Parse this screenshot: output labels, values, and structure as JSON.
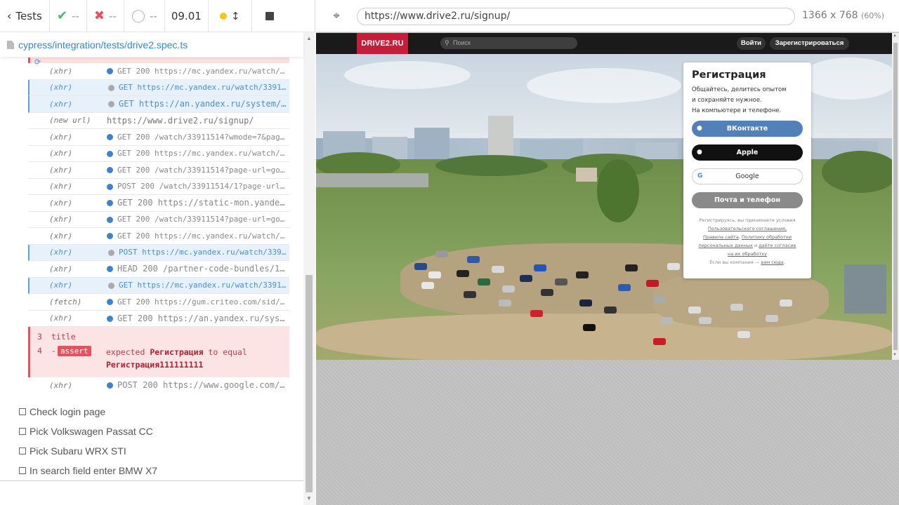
{
  "reporter": {
    "header": {
      "tests_label": "Tests",
      "passed": "--",
      "failed": "--",
      "pending": "--",
      "duration": "09.01"
    },
    "spec_path": "cypress/integration/tests/drive2.spec.ts",
    "commands": [
      {
        "kind": "(xhr)",
        "dot": "blue",
        "text": "GET 200 https://mc.yandex.ru/watch/339115…",
        "pending": false
      },
      {
        "kind": "(xhr)",
        "dot": "grey",
        "text": "GET https://mc.yandex.ru/watch/33911514?p…",
        "pending": true
      },
      {
        "kind": "(xhr)",
        "dot": "grey",
        "text": "GET https://an.yandex.ru/system/co…",
        "pending": true,
        "big": true
      },
      {
        "kind": "(new url)",
        "text": "https://www.drive2.ru/signup/",
        "newurl": true
      },
      {
        "kind": "(xhr)",
        "dot": "blue",
        "text": "GET 200 /watch/33911514?wmode=7&page-url=…",
        "pending": false
      },
      {
        "kind": "(xhr)",
        "dot": "blue",
        "text": "GET 200 https://mc.yandex.ru/watch/339115…",
        "pending": false
      },
      {
        "kind": "(xhr)",
        "dot": "blue",
        "text": "GET 200 /watch/33911514?page-url=goal://w…",
        "pending": false
      },
      {
        "kind": "(xhr)",
        "dot": "blue",
        "text": "POST 200 /watch/33911514/1?page-url=https…",
        "pending": false
      },
      {
        "kind": "(xhr)",
        "dot": "blue",
        "text": "GET 200 https://static-mon.yandex.…",
        "pending": false,
        "big": true
      },
      {
        "kind": "(xhr)",
        "dot": "blue",
        "text": "GET 200 /watch/33911514?page-url=goal://w…",
        "pending": false
      },
      {
        "kind": "(xhr)",
        "dot": "blue",
        "text": "GET 200 https://mc.yandex.ru/watch/339115…",
        "pending": false
      },
      {
        "kind": "(xhr)",
        "dot": "grey",
        "text": "POST https://mc.yandex.ru/watch/33911514/…",
        "pending": true
      },
      {
        "kind": "(xhr)",
        "dot": "blue",
        "text": "HEAD 200 /partner-code-bundles/135…",
        "pending": false,
        "big": true
      },
      {
        "kind": "(xhr)",
        "dot": "grey",
        "text": "GET https://mc.yandex.ru/watch/33911514?p…",
        "pending": true
      },
      {
        "kind": "(fetch)",
        "dot": "blue",
        "text": "GET 200 https://gum.criteo.com/sid/json?o…",
        "pending": false
      },
      {
        "kind": "(xhr)",
        "dot": "blue",
        "text": "GET 200 https://an.yandex.ru/syste…",
        "pending": false,
        "big": true
      }
    ],
    "error": {
      "line3_num": "3",
      "line3_label": "title",
      "line4_num": "4",
      "line4_prefix": "-",
      "badge": "assert",
      "expected_word": "expected",
      "actual": "Регистрация",
      "to_equal": "to equal",
      "expected_value": "Регистрация111111111"
    },
    "last_command": {
      "kind": "(xhr)",
      "dot": "blue",
      "text": "POST 200 https://www.google.com/re…"
    },
    "tests": [
      "Check login page",
      "Pick Volkswagen Passat CC",
      "Pick Subaru WRX STI",
      "In search field enter BMW X7"
    ]
  },
  "aut": {
    "url": "https://www.drive2.ru/signup/",
    "viewport": "1366 x 768",
    "scale": "(60%)",
    "site": {
      "logo": "DRIVE2.RU",
      "search_placeholder": "Поиск",
      "login": "Войти",
      "register": "Зарегистрироваться"
    },
    "signup": {
      "title": "Регистрация",
      "desc_1": "Общайтесь, делитесь опытом",
      "desc_2": "и сохраняйте нужное.",
      "desc_3": "На компьютере и телефоне.",
      "vk": "ВКонтакте",
      "apple": "Apple",
      "google": "Google",
      "mail": "Почта и телефон",
      "terms_1": "Регистрируясь, вы принимаете условия",
      "terms_2": "Пользовательского соглашения,",
      "terms_3": "Правила сайта",
      "terms_3b": ", ",
      "terms_4": "Политику обработки",
      "terms_5": "персональных данных",
      "terms_5b": " и ",
      "terms_6": "даёте согласие",
      "terms_7": "на их обработку",
      "terms_8": "Если вы компания — ",
      "terms_9": "вам сюда",
      "terms_9b": "."
    }
  }
}
